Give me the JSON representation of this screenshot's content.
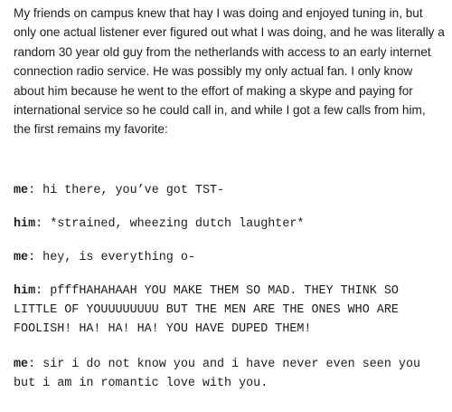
{
  "intro": "My friends on campus knew that hay I was doing and enjoyed tuning in, but only one actual listener ever figured out what I was doing, and he was literally a random 30 year old guy from the netherlands with access to an early internet connection radio service. He was possibly my only actual fan. I only know about him because he went to the effort of making a skype and paying for international service so he could call in, and while I got a few calls from him, the first remains my favorite:",
  "dialogue": [
    {
      "speaker": "me",
      "text": "hi there, you’ve got TST-"
    },
    {
      "speaker": "him",
      "text": "*strained, wheezing dutch laughter*"
    },
    {
      "speaker": "me",
      "text": "hey, is everything o-"
    },
    {
      "speaker": "him",
      "text": "pfffHAHAHAAH YOU MAKE THEM SO MAD. THEY THINK SO LITTLE OF YOUUUUUUUU BUT THE MEN ARE THE ONES WHO ARE FOOLISH! HA! HA! HA! YOU HAVE DUPED THEM!"
    },
    {
      "speaker": "me",
      "text": "sir i do not know you and i have never even seen you but i am in romantic love with you."
    }
  ]
}
